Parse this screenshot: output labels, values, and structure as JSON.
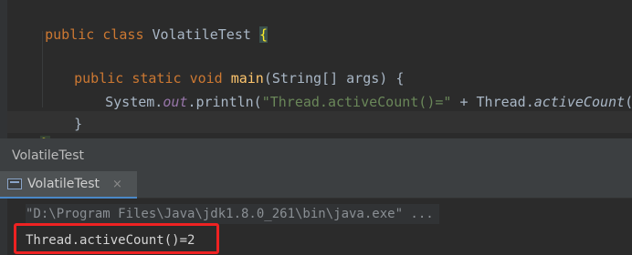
{
  "editor": {
    "lines": [
      {
        "kw1": "public ",
        "kw2": "class ",
        "name": "VolatileTest ",
        "brace": "{"
      },
      {
        "kw1": "public ",
        "kw2": "static ",
        "kw3": "void ",
        "fn": "main",
        "rest": "(String[] args) {"
      },
      {
        "pre": "System.",
        "static_field": "out",
        "mid": ".println(",
        "str": "\"Thread.activeCount()=\"",
        "plus": " + Thread.",
        "method": "activeCount",
        "end": "());"
      },
      {
        "text": "}"
      },
      {
        "text": "}"
      }
    ]
  },
  "run_panel": {
    "title": "VolatileTest",
    "tab_label": "VolatileTest",
    "tab_close": "×"
  },
  "console": {
    "command": "\"D:\\Program Files\\Java\\jdk1.8.0_261\\bin\\java.exe\" ...",
    "output": "Thread.activeCount()=2"
  },
  "colors": {
    "editor_bg": "#2b2b2b",
    "keyword": "#cc7832",
    "function": "#ffc66d",
    "string": "#6a8759",
    "static_field": "#9876aa",
    "highlight_box": "#ee2222"
  }
}
